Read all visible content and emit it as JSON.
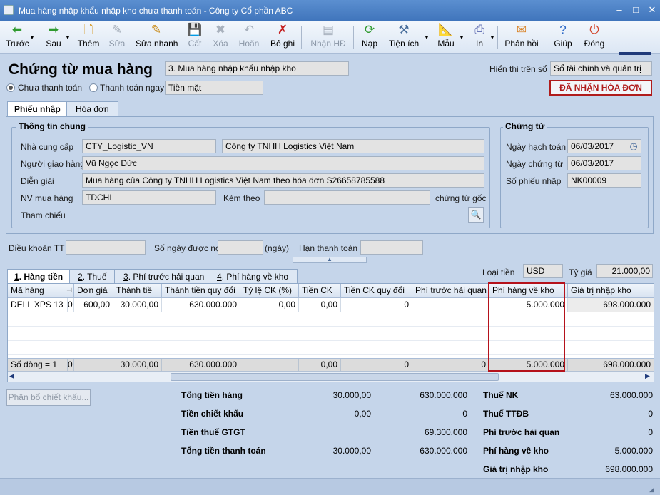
{
  "window": {
    "title": "Mua hàng nhập khẩu nhập kho chưa thanh toán - Công ty Cổ phần ABC",
    "min": "–",
    "max": "□",
    "close": "✕"
  },
  "toolbar": {
    "back": "Trước",
    "next": "Sau",
    "add": "Thêm",
    "edit": "Sửa",
    "quick_edit": "Sửa nhanh",
    "save": "Cất",
    "delete": "Xóa",
    "undo": "Hoãn",
    "unpost": "Bỏ ghi",
    "receive_invoice": "Nhận HĐ",
    "reload": "Nạp",
    "utilities": "Tiện ích",
    "template": "Mẫu",
    "print": "In",
    "feedback": "Phản hồi",
    "help": "Giúp",
    "close": "Đóng"
  },
  "header": {
    "title": "Chứng từ mua hàng",
    "type_value": "3. Mua hàng nhập khẩu nhập kho",
    "display_label": "Hiển thị trên sổ",
    "display_value": "Sổ tài chính và quản trị",
    "unpaid": "Chưa thanh toán",
    "paid_now": "Thanh toán ngay",
    "pay_method": "Tiền mặt",
    "status_button": "ĐÃ NHẬN HÓA ĐƠN"
  },
  "tabs": {
    "receipt": "Phiếu nhập",
    "invoice": "Hóa đơn"
  },
  "general": {
    "title": "Thông tin chung",
    "supplier_label": "Nhà cung cấp",
    "supplier_code": "CTY_Logistic_VN",
    "supplier_name": "Công ty TNHH Logistics Việt Nam",
    "deliverer_label": "Người giao hàng",
    "deliverer": "Vũ Ngọc Đức",
    "desc_label": "Diễn giải",
    "desc": "Mua hàng của Công ty TNHH Logistics Việt Nam theo hóa đơn S26658785588",
    "buyer_label": "NV mua hàng",
    "buyer": "TDCHI",
    "attach_label": "Kèm theo",
    "attach_value": "",
    "orig_docs": "chứng từ gốc",
    "ref_label": "Tham chiếu"
  },
  "voucher": {
    "title": "Chứng từ",
    "post_date_label": "Ngày hạch toán",
    "post_date": "06/03/2017",
    "doc_date_label": "Ngày chứng từ",
    "doc_date": "06/03/2017",
    "receipt_no_label": "Số phiếu nhập",
    "receipt_no": "NK00009"
  },
  "terms": {
    "payment_terms": "Điều khoản TT",
    "credit_days": "Số ngày được nợ",
    "days_unit": "(ngày)",
    "due_date": "Hạn thanh toán"
  },
  "currency": {
    "label": "Loại tiền",
    "value": "USD",
    "rate_label": "Tỷ giá",
    "rate": "21.000,00"
  },
  "detail_tabs": [
    {
      "num": "1",
      "label": ". Hàng tiền"
    },
    {
      "num": "2",
      "label": ". Thuế"
    },
    {
      "num": "3",
      "label": ". Phí trước hải quan"
    },
    {
      "num": "4",
      "label": ". Phí hàng về kho"
    }
  ],
  "grid": {
    "headers": [
      "Mã hàng",
      "Đơn giá",
      "Thành tiề",
      "Thành tiền quy đổi",
      "Tỷ lệ CK (%)",
      "Tiền CK",
      "Tiền CK quy đổi",
      "Phí trước hải quan",
      "Phí hàng về kho",
      "Giá trị nhập kho"
    ],
    "pin": "⊣",
    "row": {
      "code": "DELL XPS 13",
      "qty": "0",
      "price": "600,00",
      "amount": "30.000,00",
      "amount_conv": "630.000.000",
      "disc_rate": "0,00",
      "disc": "0,00",
      "disc_conv": "0",
      "pre_customs": "",
      "to_wh_fee": "5.000.000",
      "import_value": "698.000.000"
    },
    "summary": {
      "rows": "Số dòng = 1",
      "qty": "0",
      "amount": "30.000,00",
      "amount_conv": "630.000.000",
      "disc": "0,00",
      "disc_conv": "0",
      "pre_customs": "0",
      "to_wh_fee": "5.000.000",
      "import_value": "698.000.000"
    }
  },
  "bottom": {
    "allocate_button": "Phân bổ chiết khấu...",
    "total_goods": "Tổng tiền hàng",
    "total_goods_fc": "30.000,00",
    "total_goods_lc": "630.000.000",
    "discount": "Tiền chiết khấu",
    "discount_fc": "0,00",
    "discount_lc": "0",
    "vat": "Tiền thuế GTGT",
    "vat_lc": "69.300.000",
    "grand_total": "Tổng tiền thanh toán",
    "grand_total_fc": "30.000,00",
    "grand_total_lc": "630.000.000",
    "import_tax": "Thuế NK",
    "import_tax_v": "63.000.000",
    "excise": "Thuế TTĐB",
    "excise_v": "0",
    "pre_customs": "Phí trước hải quan",
    "pre_customs_v": "0",
    "wh_fee": "Phí hàng về kho",
    "wh_fee_v": "5.000.000",
    "import_value": "Giá trị nhập kho",
    "import_value_v": "698.000.000"
  },
  "colors": {
    "accent": "#b01c1c",
    "titlebar": "#3f74bb",
    "highlight_box": "#b5121b"
  }
}
